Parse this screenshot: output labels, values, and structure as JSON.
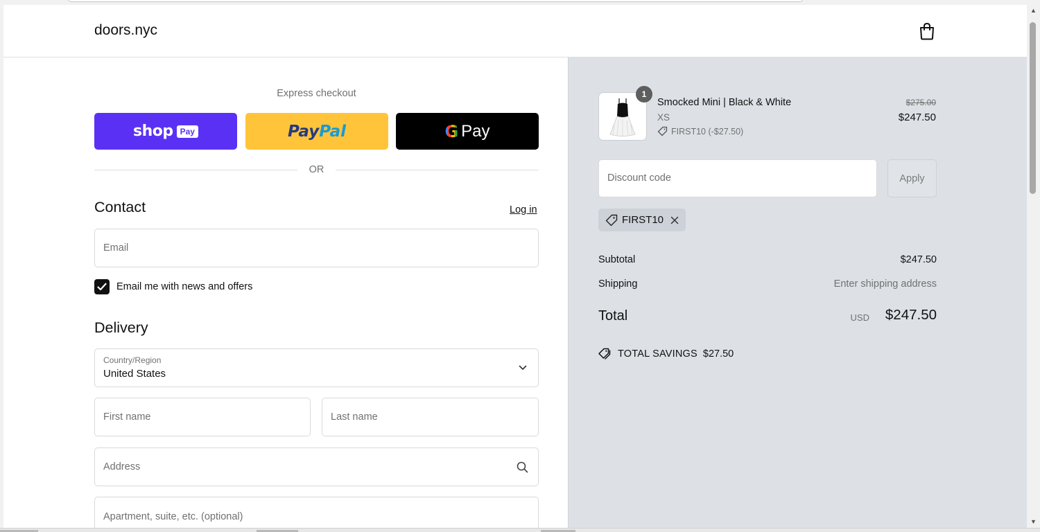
{
  "store": {
    "name": "doors.nyc"
  },
  "express": {
    "title": "Express checkout",
    "shop_pay": {
      "brand": "shop",
      "badge": "Pay"
    },
    "paypal": {
      "part1": "Pay",
      "part2": "Pal"
    },
    "gpay": {
      "g": "G",
      "pay": "Pay"
    },
    "divider": "OR"
  },
  "contact": {
    "title": "Contact",
    "login_label": "Log in",
    "email_placeholder": "Email",
    "news_label": "Email me with news and offers",
    "news_checked": true
  },
  "delivery": {
    "title": "Delivery",
    "country_label": "Country/Region",
    "country_value": "United States",
    "first_name_placeholder": "First name",
    "last_name_placeholder": "Last name",
    "address_placeholder": "Address",
    "apartment_placeholder": "Apartment, suite, etc. (optional)"
  },
  "order": {
    "item": {
      "name": "Smocked Mini | Black & White",
      "variant": "XS",
      "discount": "FIRST10 (-$27.50)",
      "quantity": "1",
      "price_original": "$275.00",
      "price_final": "$247.50"
    },
    "discount_placeholder": "Discount code",
    "apply_label": "Apply",
    "applied_code": "FIRST10",
    "subtotal_label": "Subtotal",
    "subtotal_value": "$247.50",
    "shipping_label": "Shipping",
    "shipping_value": "Enter shipping address",
    "total_label": "Total",
    "total_currency": "USD",
    "total_value": "$247.50",
    "savings_label": "TOTAL SAVINGS",
    "savings_value": "$27.50"
  },
  "colors": {
    "shop_pay": "#5a31f4",
    "paypal": "#ffc439",
    "gpay": "#000000",
    "summary_bg": "#dde1e6"
  }
}
